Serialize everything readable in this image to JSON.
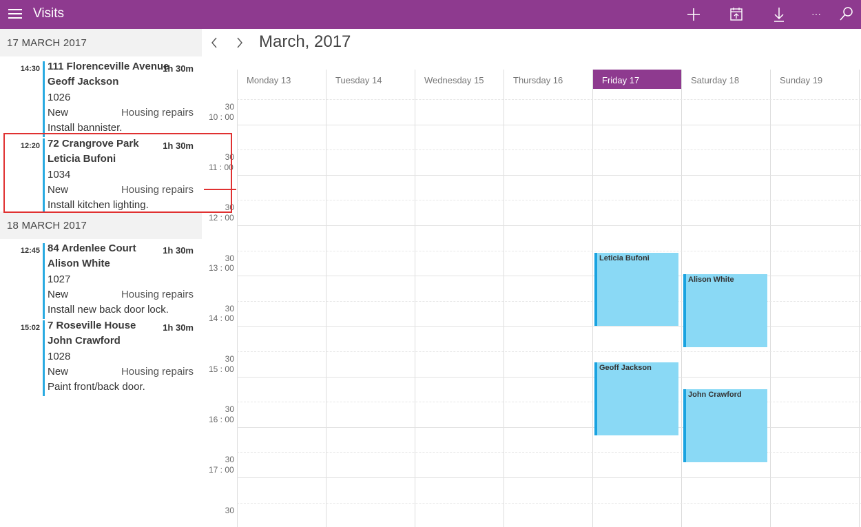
{
  "app": {
    "title": "Visits"
  },
  "toolbar": {
    "icons": [
      "add-icon",
      "calendar-icon",
      "download-icon",
      "more-icon",
      "search-icon"
    ],
    "more_label": "···"
  },
  "agenda": {
    "days": [
      {
        "label": "17 MARCH 2017",
        "visits": [
          {
            "time": "14:30",
            "address": "111 Florenceville Avenue",
            "duration": "1h 30m",
            "name": "Geoff Jackson",
            "id": "1026",
            "status": "New",
            "category": "Housing repairs",
            "note": "Install bannister."
          },
          {
            "time": "12:20",
            "address": "72 Crangrove Park",
            "duration": "1h 30m",
            "name": "Leticia Bufoni",
            "id": "1034",
            "status": "New",
            "category": "Housing repairs",
            "note": "Install kitchen lighting."
          }
        ]
      },
      {
        "label": "18 MARCH 2017",
        "visits": [
          {
            "time": "12:45",
            "address": "84 Ardenlee Court",
            "duration": "1h 30m",
            "name": "Alison White",
            "id": "1027",
            "status": "New",
            "category": "Housing repairs",
            "note": "Install new back door lock."
          },
          {
            "time": "15:02",
            "address": "7 Roseville House",
            "duration": "1h 30m",
            "name": "John Crawford",
            "id": "1028",
            "status": "New",
            "category": "Housing repairs",
            "note": "Paint front/back door."
          }
        ]
      }
    ]
  },
  "calendar": {
    "title": "March, 2017",
    "days": [
      "Monday 13",
      "Tuesday 14",
      "Wednesday 15",
      "Thursday 16",
      "Friday 17",
      "Saturday 18",
      "Sunday 19"
    ],
    "today_index": 4,
    "time_labels": [
      "30",
      "10 : 00",
      "30",
      "11 : 00",
      "30",
      "12 : 00",
      "30",
      "13 : 00",
      "30",
      "14 : 00",
      "30",
      "15 : 00",
      "30",
      "16 : 00",
      "30",
      "17 : 00",
      "30"
    ],
    "events": [
      {
        "day": "Friday 17",
        "label": "Leticia Bufoni",
        "start": "12:20",
        "end": "13:50"
      },
      {
        "day": "Friday 17",
        "label": "Geoff Jackson",
        "start": "14:30",
        "end": "16:00"
      },
      {
        "day": "Saturday 18",
        "label": "Alison White",
        "start": "12:45",
        "end": "14:15"
      },
      {
        "day": "Saturday 18",
        "label": "John Crawford",
        "start": "15:02",
        "end": "16:32"
      }
    ]
  },
  "colors": {
    "accent": "#8e3a8f",
    "event_fill": "#8ad9f5",
    "event_bar": "#1aa3e0",
    "agenda_bar": "#29aae1",
    "highlight": "#e03131"
  }
}
